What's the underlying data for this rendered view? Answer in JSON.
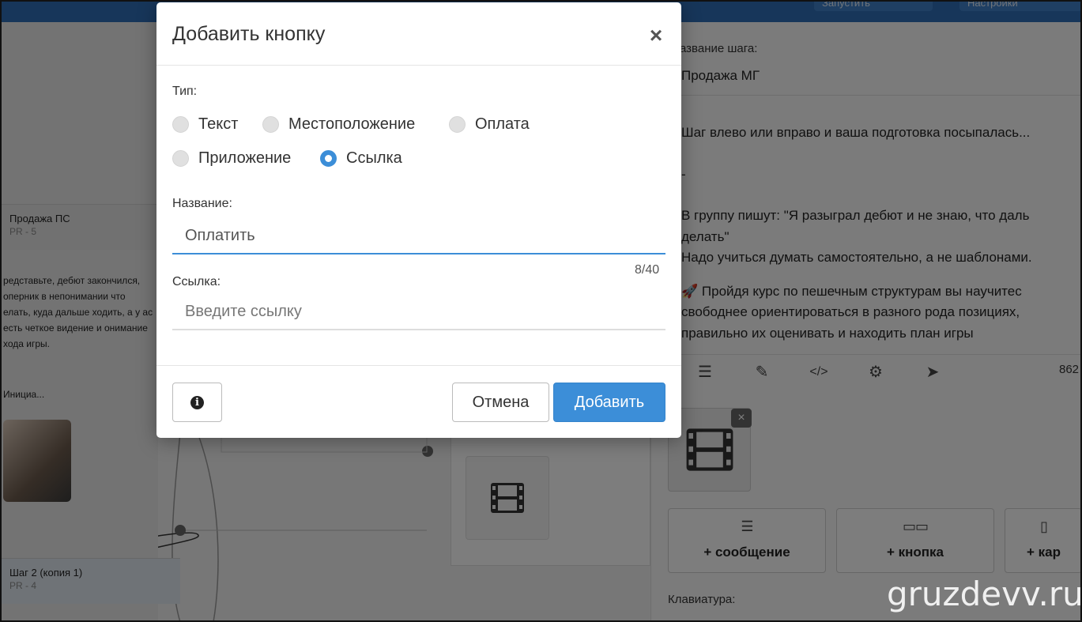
{
  "background": {
    "topbar_buttons": [
      "Запустить",
      "Настройки"
    ],
    "nodes": [
      {
        "title": "Продажа ПС",
        "sub": "PR - 5"
      },
      {
        "title": "Шаг 2 (копия 1)",
        "sub": "PR - 4"
      }
    ],
    "left_text": "редставьте, дебют закончился, оперник в непонимании что елать, куда дальше ходить, а у ас есть четкое видение и онимание хода игры.",
    "init_label": "Инициа...",
    "right_panel": {
      "step_name_label": "азвание шага:",
      "step_name_value": "Продажа МГ",
      "message_lines": [
        "Шаг влево или вправо и ваша подготовка посыпалась...",
        "-",
        "В группу пишут: \"Я разыграл дебют и не знаю, что даль",
        "делать\"",
        "Надо учиться думать самостоятельно, а не шаблонами.",
        "🚀 Пройдя курс по пешечным структурам вы научитес",
        "свободнее ориентироваться в разного рода позициях,",
        "правильно их оценивать и находить план игры"
      ],
      "char_count": "862",
      "media_close": "×",
      "add_message": "+ сообщение",
      "add_button": "+ кнопка",
      "add_card": "+ кар",
      "keyboard_label": "Клавиатура:"
    },
    "watermark": "gruzdevv.ru"
  },
  "modal": {
    "title": "Добавить кнопку",
    "close": "×",
    "type_label": "Тип:",
    "types": [
      {
        "label": "Текст",
        "checked": false
      },
      {
        "label": "Местоположение",
        "checked": false
      },
      {
        "label": "Оплата",
        "checked": false
      },
      {
        "label": "Приложение",
        "checked": false
      },
      {
        "label": "Ссылка",
        "checked": true
      }
    ],
    "name_label": "Название:",
    "name_value": "Оплатить",
    "name_counter": "8/40",
    "link_label": "Ссылка:",
    "link_placeholder": "Введите ссылку",
    "link_value": "",
    "info_icon": "i",
    "cancel_label": "Отмена",
    "add_label": "Добавить"
  },
  "colors": {
    "accent": "#3c8ed8",
    "topbar": "#2f6db4"
  }
}
